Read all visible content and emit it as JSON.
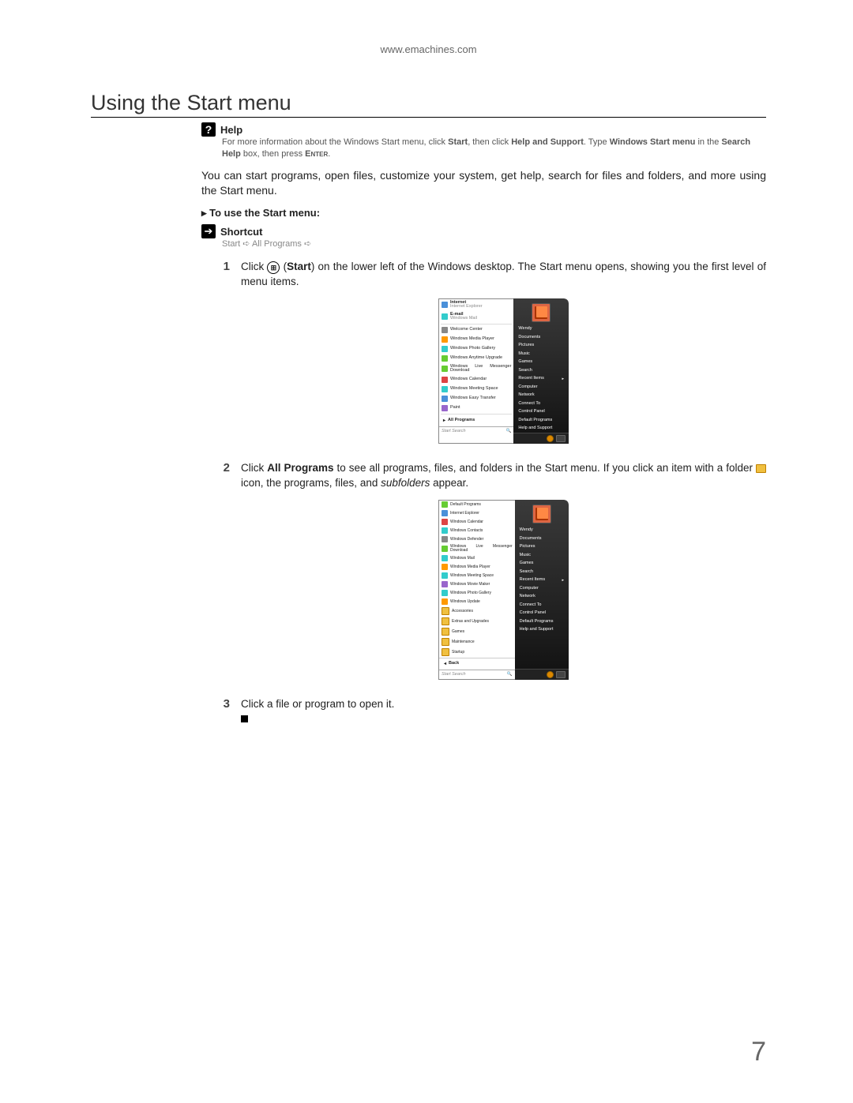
{
  "header": {
    "url": "www.emachines.com"
  },
  "title": "Using the Start menu",
  "help": {
    "label": "Help",
    "text_1": "For more information about the Windows Start menu, click ",
    "bold_1": "Start",
    "text_2": ", then click ",
    "bold_2": "Help and Support",
    "text_3": ". Type ",
    "bold_3": "Windows Start menu",
    "text_4": " in the ",
    "bold_4": "Search Help",
    "text_5": " box, then press ",
    "smallcaps": "Enter",
    "text_6": "."
  },
  "intro": "You can start programs, open files, customize your system, get help, search for files and folders, and more using the Start menu.",
  "instr_heading": "To use the Start menu:",
  "shortcut": {
    "label": "Shortcut",
    "path": "Start ➪ All Programs ➪"
  },
  "steps": {
    "s1_a": "Click ",
    "s1_b": " (",
    "s1_bold": "Start",
    "s1_c": ") on the lower left of the Windows desktop. The Start menu opens, showing you the first level of menu items.",
    "s2_a": "Click ",
    "s2_bold": "All Programs",
    "s2_b": " to see all programs, files, and folders in the Start menu. If you click an item with a folder ",
    "s2_c": " icon, the programs, files, and ",
    "s2_italic": "subfolders",
    "s2_d": " appear.",
    "s3": "Click a file or program to open it."
  },
  "menu1": {
    "left": [
      {
        "label": "Internet",
        "sub": "Internet Explorer",
        "ic": "ic-blue"
      },
      {
        "label": "E-mail",
        "sub": "Windows Mail",
        "ic": "ic-teal"
      },
      {
        "label": "Welcome Center",
        "ic": "ic-gray"
      },
      {
        "label": "Windows Media Player",
        "ic": "ic-orange"
      },
      {
        "label": "Windows Photo Gallery",
        "ic": "ic-teal"
      },
      {
        "label": "Windows Anytime Upgrade",
        "ic": "ic-green"
      },
      {
        "label": "Windows Live Messenger Download",
        "ic": "ic-green"
      },
      {
        "label": "Windows Calendar",
        "ic": "ic-red"
      },
      {
        "label": "Windows Meeting Space",
        "ic": "ic-teal"
      },
      {
        "label": "Windows Easy Transfer",
        "ic": "ic-blue"
      },
      {
        "label": "Paint",
        "ic": "ic-purple"
      }
    ],
    "all_programs": "All Programs",
    "search": "Start Search"
  },
  "menu2": {
    "left": [
      {
        "label": "Default Programs",
        "ic": "ic-green"
      },
      {
        "label": "Internet Explorer",
        "ic": "ic-blue"
      },
      {
        "label": "Windows Calendar",
        "ic": "ic-red"
      },
      {
        "label": "Windows Contacts",
        "ic": "ic-teal"
      },
      {
        "label": "Windows Defender",
        "ic": "ic-gray"
      },
      {
        "label": "Windows Live Messenger Download",
        "ic": "ic-green"
      },
      {
        "label": "Windows Mail",
        "ic": "ic-teal"
      },
      {
        "label": "Windows Media Player",
        "ic": "ic-orange"
      },
      {
        "label": "Windows Meeting Space",
        "ic": "ic-teal"
      },
      {
        "label": "Windows Movie Maker",
        "ic": "ic-purple"
      },
      {
        "label": "Windows Photo Gallery",
        "ic": "ic-teal"
      },
      {
        "label": "Windows Update",
        "ic": "ic-orange"
      },
      {
        "label": "Accessories",
        "ic": "ic-yellow"
      },
      {
        "label": "Extras and Upgrades",
        "ic": "ic-yellow"
      },
      {
        "label": "Games",
        "ic": "ic-yellow"
      },
      {
        "label": "Maintenance",
        "ic": "ic-yellow"
      },
      {
        "label": "Startup",
        "ic": "ic-yellow"
      }
    ],
    "back": "Back",
    "search": "Start Search"
  },
  "right_panel": [
    {
      "label": "Wendy"
    },
    {
      "label": "Documents"
    },
    {
      "label": "Pictures"
    },
    {
      "label": "Music"
    },
    {
      "label": "Games"
    },
    {
      "label": "Search"
    },
    {
      "label": "Recent Items",
      "submenu": true
    },
    {
      "label": "Computer"
    },
    {
      "label": "Network"
    },
    {
      "label": "Connect To"
    },
    {
      "label": "Control Panel"
    },
    {
      "label": "Default Programs"
    },
    {
      "label": "Help and Support"
    }
  ],
  "page_number": "7"
}
